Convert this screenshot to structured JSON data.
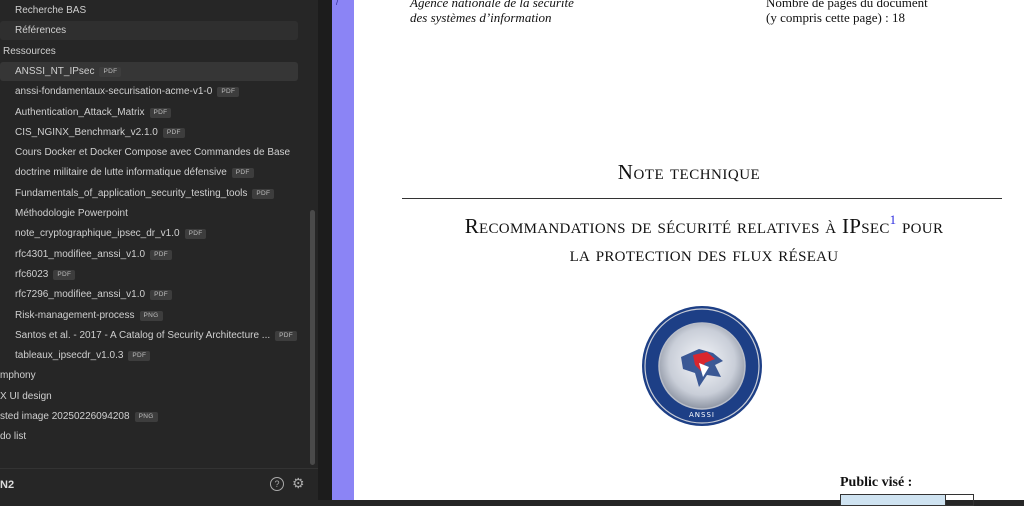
{
  "sidebar": {
    "items": [
      {
        "label": "Recherche BAS",
        "badge": "",
        "level": "file",
        "state": ""
      },
      {
        "label": "Références",
        "badge": "",
        "level": "file",
        "state": "sel"
      },
      {
        "label": "Ressources",
        "badge": "",
        "level": "folder",
        "state": ""
      },
      {
        "label": "ANSSI_NT_IPsec",
        "badge": "PDF",
        "level": "file",
        "state": "active"
      },
      {
        "label": "anssi-fondamentaux-securisation-acme-v1-0",
        "badge": "PDF",
        "level": "file",
        "state": ""
      },
      {
        "label": "Authentication_Attack_Matrix",
        "badge": "PDF",
        "level": "file",
        "state": ""
      },
      {
        "label": "CIS_NGINX_Benchmark_v2.1.0",
        "badge": "PDF",
        "level": "file",
        "state": ""
      },
      {
        "label": "Cours Docker et Docker Compose avec Commandes de Base",
        "badge": "",
        "level": "file",
        "state": ""
      },
      {
        "label": "doctrine militaire de lutte informatique défensive",
        "badge": "PDF",
        "level": "file",
        "state": ""
      },
      {
        "label": "Fundamentals_of_application_security_testing_tools",
        "badge": "PDF",
        "level": "file",
        "state": ""
      },
      {
        "label": "Méthodologie Powerpoint",
        "badge": "",
        "level": "file",
        "state": ""
      },
      {
        "label": "note_cryptographique_ipsec_dr_v1.0",
        "badge": "PDF",
        "level": "file",
        "state": ""
      },
      {
        "label": "rfc4301_modifiee_anssi_v1.0",
        "badge": "PDF",
        "level": "file",
        "state": ""
      },
      {
        "label": "rfc6023",
        "badge": "PDF",
        "level": "file",
        "state": ""
      },
      {
        "label": "rfc7296_modifiee_anssi_v1.0",
        "badge": "PDF",
        "level": "file",
        "state": ""
      },
      {
        "label": "Risk-management-process",
        "badge": "PNG",
        "level": "file",
        "state": ""
      },
      {
        "label": "Santos et al. - 2017 - A Catalog of Security Architecture ...",
        "badge": "PDF",
        "level": "file",
        "state": ""
      },
      {
        "label": "tableaux_ipsecdr_v1.0.3",
        "badge": "PDF",
        "level": "file",
        "state": ""
      },
      {
        "label": "mphony",
        "badge": "",
        "level": "root",
        "state": ""
      },
      {
        "label": "X UI design",
        "badge": "",
        "level": "root",
        "state": ""
      },
      {
        "label": "sted image 20250226094208",
        "badge": "PNG",
        "level": "root",
        "state": ""
      },
      {
        "label": "do list",
        "badge": "",
        "level": "root",
        "state": ""
      }
    ],
    "vault_name": "N2",
    "help_icon": "help-circle-icon",
    "settings_icon": "gear-icon"
  },
  "document": {
    "agency_line1": "Agence nationale de la sécurité",
    "agency_line2": "des systèmes d’information",
    "pagecount_line1": "Nombre de pages du document",
    "pagecount_line2": "(y compris cette page) : 18",
    "note_title": "Note technique",
    "main_title_line1": "Recommandations de sécurité relatives à IPsec",
    "footnote_mark": "1",
    "main_title_line1_end": " pour",
    "main_title_line2": "la protection des flux réseau",
    "public_label": "Public visé :",
    "seal_icon": "anssi-seal-icon"
  },
  "colors": {
    "viewer_background": "#8b84f5",
    "sidebar_background": "#262626",
    "footnote": "#2a2ae0"
  }
}
